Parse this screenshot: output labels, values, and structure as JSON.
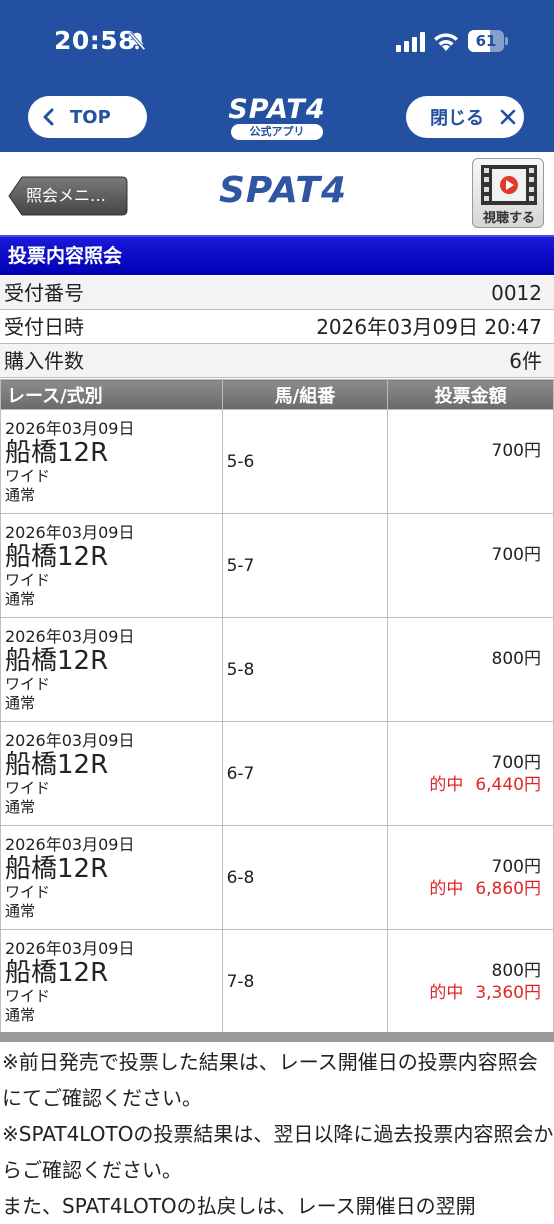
{
  "status": {
    "time": "20:58",
    "battery_level": "61"
  },
  "app_header": {
    "top_label": "TOP",
    "logo_text": "SPAT4",
    "logo_sub": "公式アプリ",
    "close_label": "閉じる"
  },
  "web_header": {
    "back_label": "照会メニ…",
    "logo_text": "SPAT4",
    "watch_label": "視聴する"
  },
  "section_title": "投票内容照会",
  "info": {
    "receipt_no_label": "受付番号",
    "receipt_no": "0012",
    "receipt_time_label": "受付日時",
    "receipt_time": "2026年03月09日 20:47",
    "count_label": "購入件数",
    "count": "6件"
  },
  "table": {
    "headers": [
      "レース/式別",
      "馬/組番",
      "投票金額"
    ],
    "rows": [
      {
        "date": "2026年03月09日",
        "race": "船橋12R",
        "type": "ワイド",
        "kind": "通常",
        "combo": "5-6",
        "amount": "700円",
        "hit_label": "",
        "hit_amount": ""
      },
      {
        "date": "2026年03月09日",
        "race": "船橋12R",
        "type": "ワイド",
        "kind": "通常",
        "combo": "5-7",
        "amount": "700円",
        "hit_label": "",
        "hit_amount": ""
      },
      {
        "date": "2026年03月09日",
        "race": "船橋12R",
        "type": "ワイド",
        "kind": "通常",
        "combo": "5-8",
        "amount": "800円",
        "hit_label": "",
        "hit_amount": ""
      },
      {
        "date": "2026年03月09日",
        "race": "船橋12R",
        "type": "ワイド",
        "kind": "通常",
        "combo": "6-7",
        "amount": "700円",
        "hit_label": "的中",
        "hit_amount": "6,440円"
      },
      {
        "date": "2026年03月09日",
        "race": "船橋12R",
        "type": "ワイド",
        "kind": "通常",
        "combo": "6-8",
        "amount": "700円",
        "hit_label": "的中",
        "hit_amount": "6,860円"
      },
      {
        "date": "2026年03月09日",
        "race": "船橋12R",
        "type": "ワイド",
        "kind": "通常",
        "combo": "7-8",
        "amount": "800円",
        "hit_label": "的中",
        "hit_amount": "3,360円"
      }
    ]
  },
  "notes": [
    "※前日発売で投票した結果は、レース開催日の投票内容照会にてご確認ください。",
    "※SPAT4LOTOの投票結果は、翌日以降に過去投票内容照会からご確認ください。",
    "また、SPAT4LOTOの払戻しは、レース開催日の翌開"
  ],
  "colors": {
    "app_blue": "#2350a1",
    "section_blue": "#0000b4",
    "hit_red": "#e0262a"
  }
}
